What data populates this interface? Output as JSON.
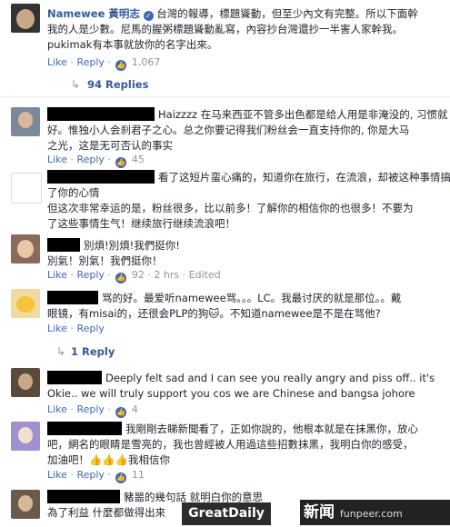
{
  "main_post": {
    "author": "Namewee 黃明志",
    "lines": [
      "台灣的報導，標題聳動，但至少內文有完整。所以下面幹",
      "我的人是少數。尼馬的腥粥標題聳動亂寫，內容抄台灣還抄一半害人家幹我。",
      "pukimak有本事就放你的名字出來。"
    ],
    "like": "Like",
    "reply": "Reply",
    "likes": "1,067",
    "replies_link": "94 Replies"
  },
  "comments": [
    {
      "lines": [
        "Haizzzz 在马来西亚不管多出色都是给人用是非淹没的, 习惯就",
        "好。惟独小人会刹君子之心。总之你要记得我们粉丝会一直支持你的, 你是大马",
        "之光，这是无可否认的事实"
      ],
      "likes": "45",
      "edited": ""
    },
    {
      "lines": [
        "看了这短片蛮心痛的，知道你在旅行，在流浪，却被这种事情搞砸",
        "了你的心情",
        "但这次非常幸运的是，粉丝很多，比以前多！了解你的相信你的也很多！不要为",
        "了这些事情生气！继续旅行继续流浪吧！"
      ],
      "likes": "1",
      "edited": ""
    },
    {
      "lines": [
        "別煩!別煩!我們挺你!",
        "別氣！別氣！我們挺你！"
      ],
      "likes": "92",
      "time": "2 hrs",
      "edited": "Edited"
    },
    {
      "lines": [
        "骂的好。最爱听namewee骂。。。LC。我最讨厌的就是那位。。戴",
        "眼镜，有misai的，还很会PLP的狗🐱。不知道namewee是不是在骂他?"
      ],
      "replies_link": "1 Reply"
    },
    {
      "lines": [
        "Deeply felt sad and I can see you really angry and piss off.. it's",
        "Okie.. we will truly support you cos we are Chinese and bangsa johore"
      ],
      "likes": "4"
    },
    {
      "lines": [
        "我剛剛去睇新聞看了，正如你說的，他根本就是在抹黑你，放心",
        "吧，網名的眼睛是雪亮的，我也曾經被人用過這些招數抹黑，我明白你的感受，",
        "加油吧！👍👍👍我相信你"
      ],
      "likes": "11"
    },
    {
      "lines": [
        "豬噐的幾句話 就明白你的意思",
        "為了利益 什麼都做得出來"
      ]
    }
  ],
  "watermarks": {
    "left": "GreatDaily",
    "right": "新闻",
    "right_sub": "funpeer.com"
  }
}
